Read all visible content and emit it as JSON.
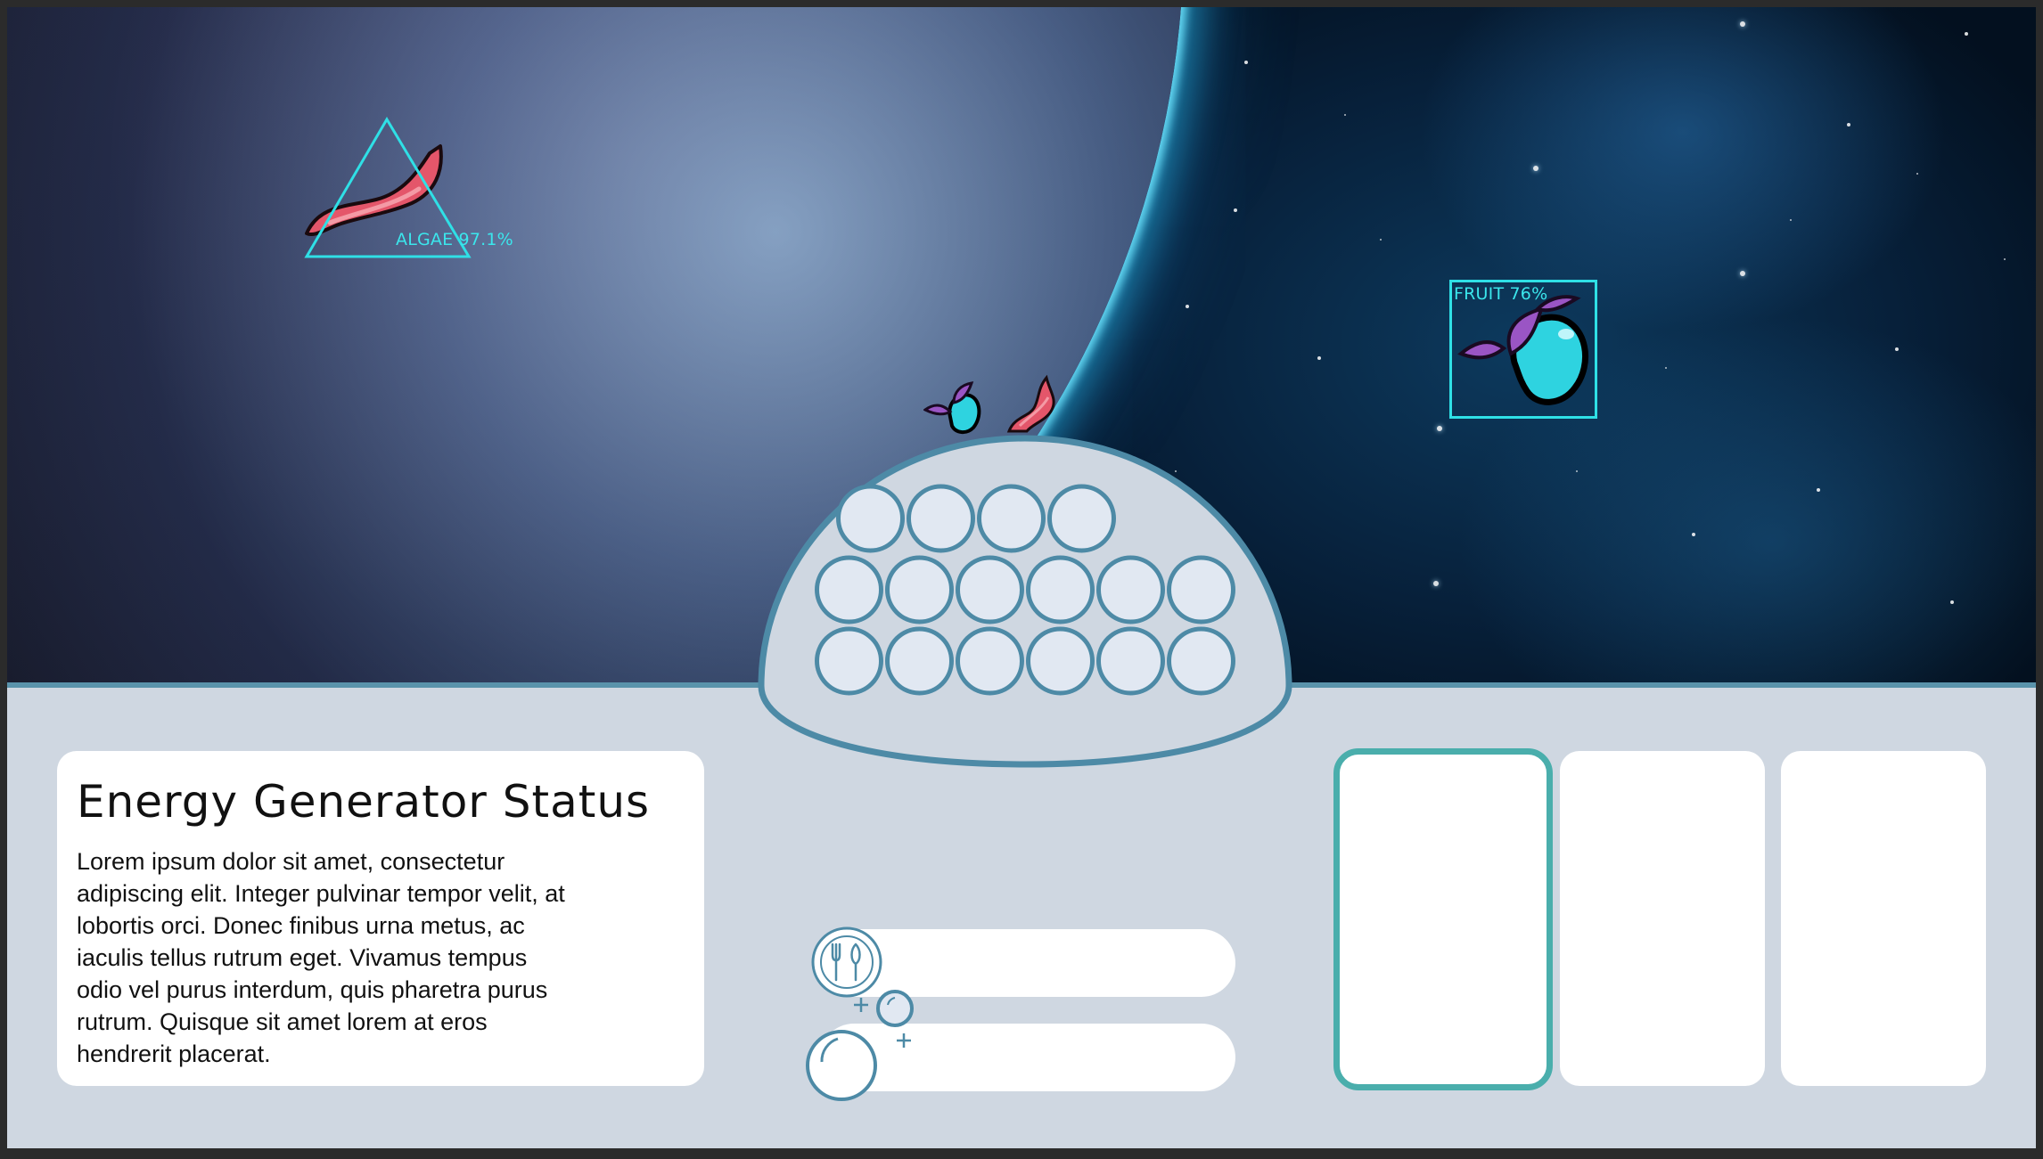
{
  "scene": {
    "detections": [
      {
        "label": "ALGAE 97.1%",
        "shape": "triangle",
        "item": "algae"
      },
      {
        "label": "FRUIT 76%",
        "shape": "box",
        "item": "fruit"
      }
    ],
    "overlay_color": "#2fe0e6"
  },
  "dome": {
    "pod_rows": [
      4,
      6,
      6
    ],
    "pod_fill": "#e1e8f2",
    "pod_stroke": "#4d8aa6"
  },
  "status_card": {
    "title": "Energy Generator Status",
    "body": "Lorem ipsum dolor sit amet, consectetur adipiscing elit. Integer pulvinar tempor velit, at lobortis orci. Donec finibus urna metus, ac iaculis tellus rutrum eget. Vivamus tempus odio vel purus interdum, quis pharetra purus rutrum. Quisque sit amet lorem at eros hendrerit placerat."
  },
  "meters": [
    {
      "name": "food",
      "icon": "fork-knife-icon"
    },
    {
      "name": "air",
      "icon": "bubbles-icon"
    }
  ],
  "slots": [
    {
      "selected": true
    },
    {
      "selected": false
    },
    {
      "selected": false
    }
  ],
  "colors": {
    "panel_bg": "#cfd7e1",
    "accent_teal": "#4aaeac",
    "dome_stroke": "#4d8aa6",
    "algae_red": "#e4566a",
    "fruit_cyan": "#2ed3e0",
    "leaf_purple": "#9a55c4"
  }
}
